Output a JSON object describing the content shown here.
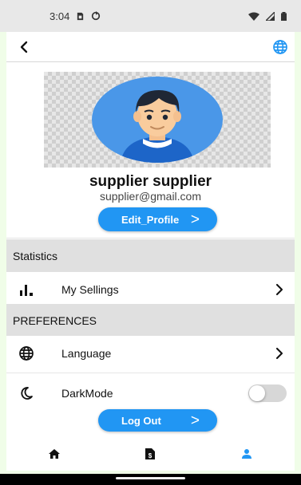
{
  "status_bar": {
    "time": "3:04",
    "icons": [
      "sim-card-icon",
      "sync-icon",
      "wifi-icon",
      "signal-icon",
      "battery-icon"
    ]
  },
  "app_bar": {
    "back_icon": "arrow-back-icon",
    "language_icon": "globe-icon"
  },
  "profile": {
    "name": "supplier supplier",
    "email": "supplier@gmail.com",
    "edit_label": "Edit_Profile",
    "edit_icon": "chevron-right-icon",
    "avatar_icon": "person-avatar"
  },
  "statistics": {
    "header": "Statistics",
    "items": [
      {
        "label": "My Sellings",
        "icon": "bar-chart-icon"
      }
    ]
  },
  "preferences": {
    "header": "PREFERENCES",
    "language_label": "Language",
    "language_icon": "globe-icon",
    "darkmode_label": "DarkMode",
    "darkmode_icon": "moon-icon",
    "darkmode_enabled": false
  },
  "logout": {
    "label": "Log Out",
    "icon": "chevron-right-icon"
  },
  "bottom_nav": {
    "items": [
      {
        "name": "home",
        "icon": "home-icon",
        "active": false
      },
      {
        "name": "orders",
        "icon": "document-dollar-icon",
        "active": false
      },
      {
        "name": "profile",
        "icon": "person-icon",
        "active": true
      }
    ]
  },
  "colors": {
    "primary": "#2196f3",
    "section_bg": "#e0e0e0",
    "status_bar_bg": "#e8e8e8"
  }
}
